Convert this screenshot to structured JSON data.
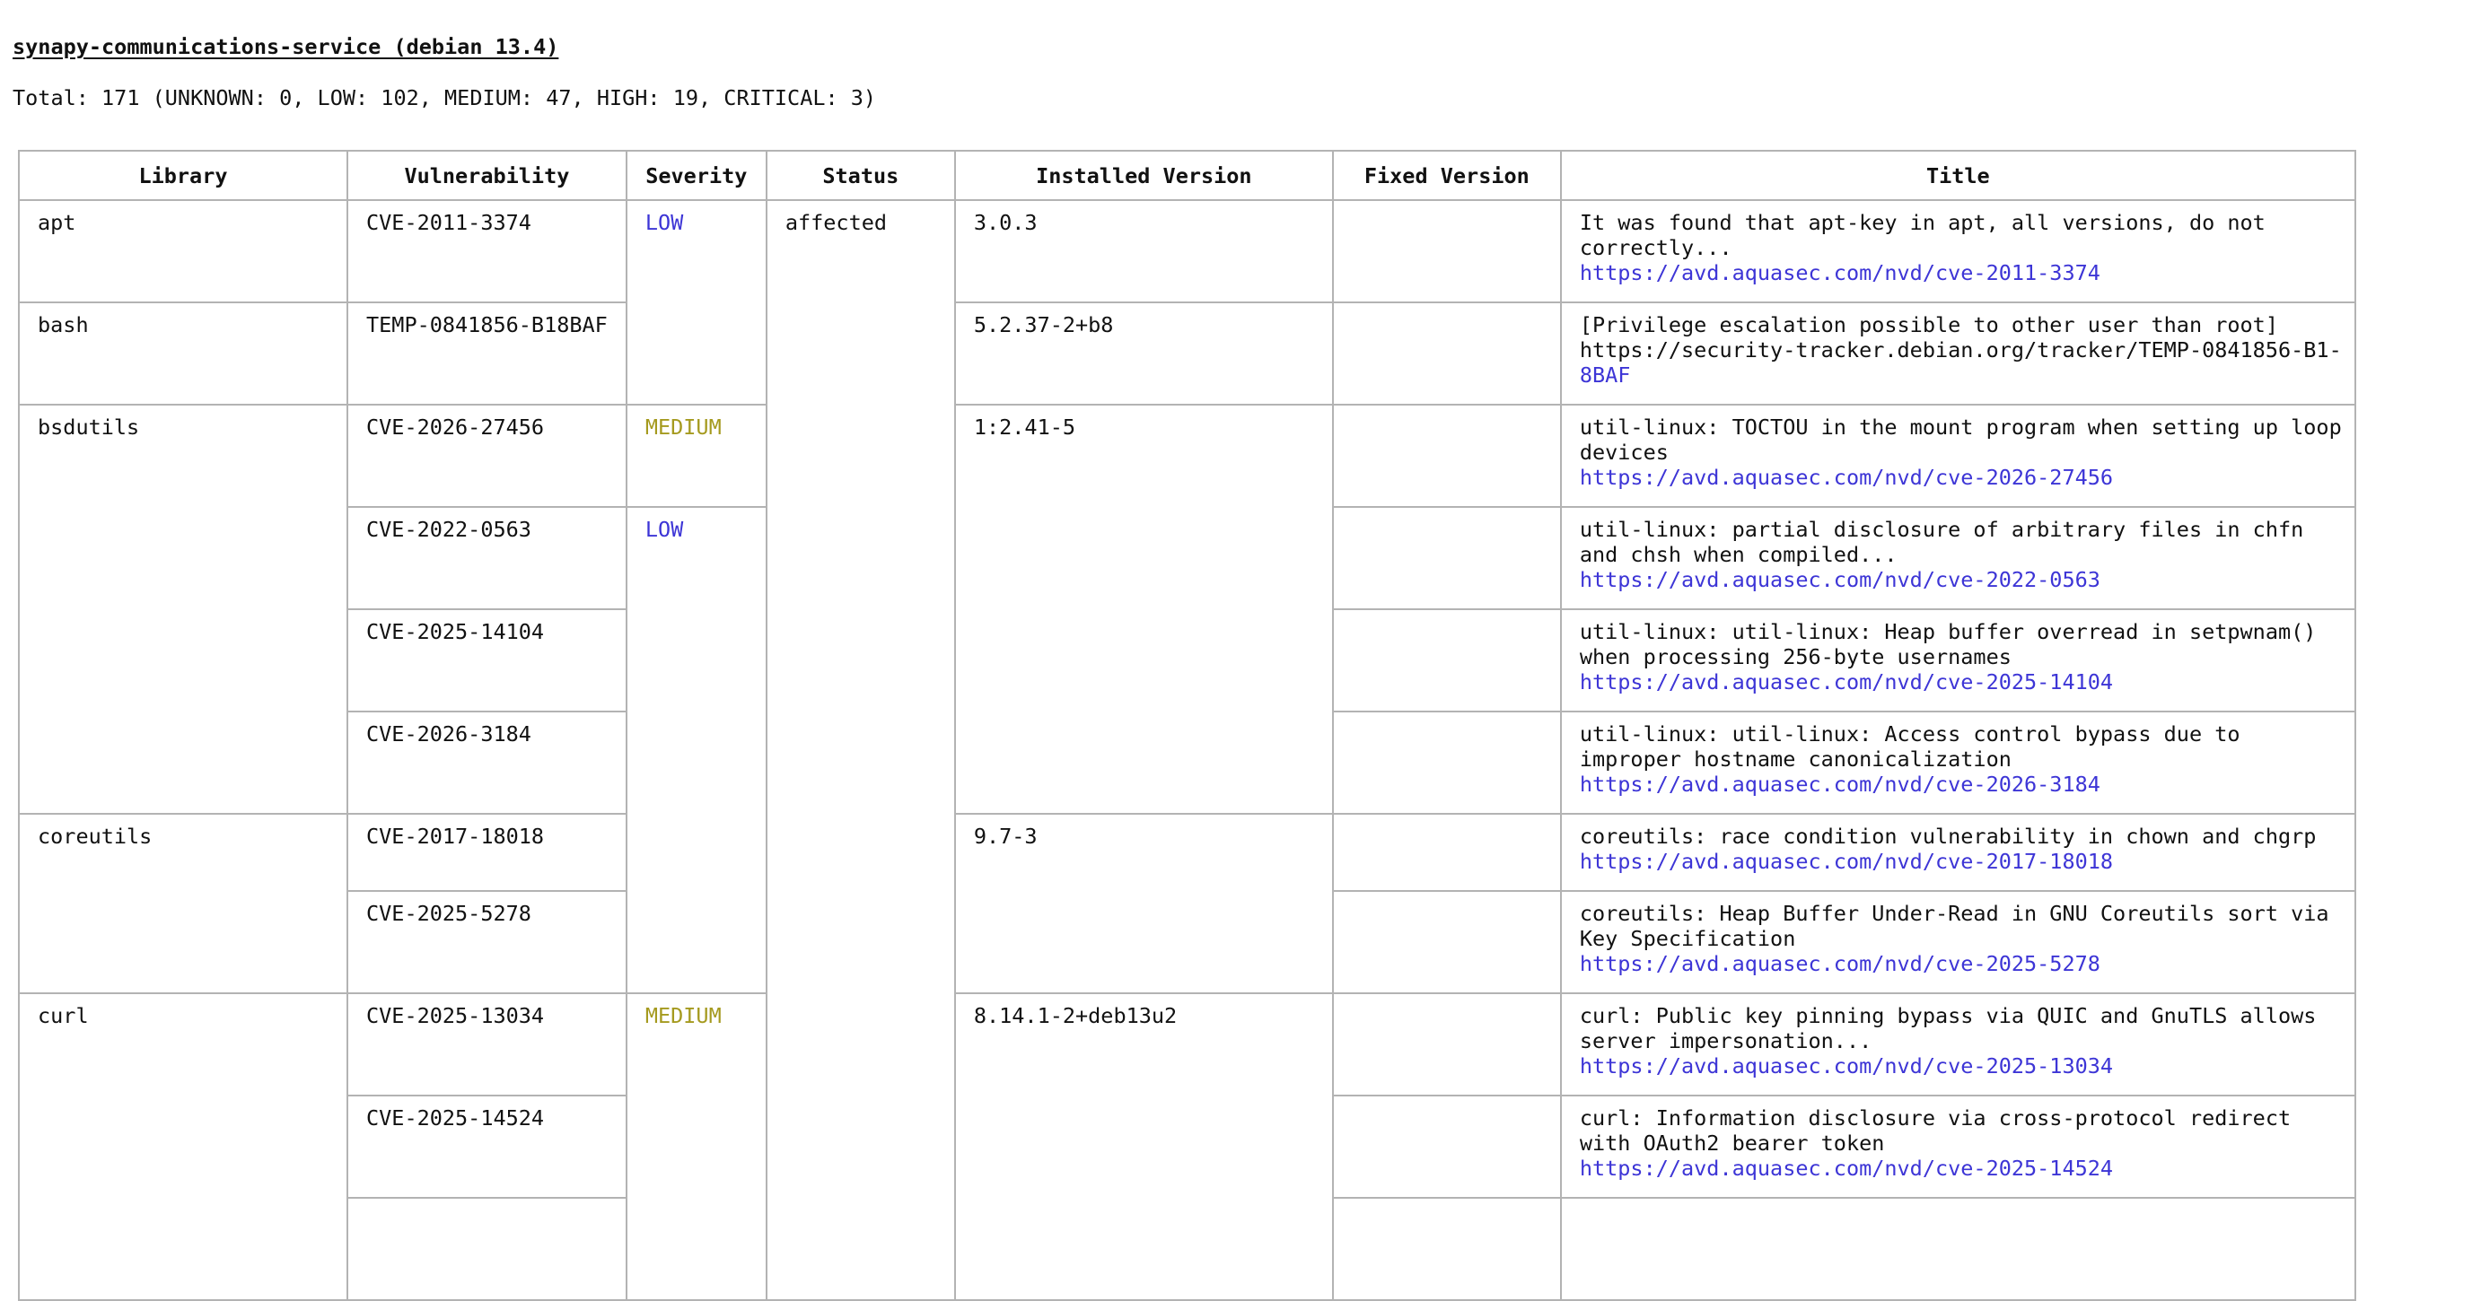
{
  "report": {
    "title": "synapy-communications-service (debian 13.4)",
    "summary": "Total: 171 (UNKNOWN: 0, LOW: 102, MEDIUM: 47, HIGH: 19, CRITICAL: 3)"
  },
  "table": {
    "headers": [
      "Library",
      "Vulnerability",
      "Severity",
      "Status",
      "Installed Version",
      "Fixed Version",
      "Title"
    ],
    "status_affected": "affected",
    "rows": [
      {
        "library": "apt",
        "vuln": "CVE-2011-3374",
        "severity": "LOW",
        "installed": "3.0.3",
        "fixed": "",
        "title": "It was found that apt-key in apt, all versions, do not correctly...",
        "link": "https://avd.aquasec.com/nvd/cve-2011-3374"
      },
      {
        "library": "bash",
        "vuln": "TEMP-0841856-B18BAF",
        "severity": "",
        "installed": "5.2.37-2+b8",
        "fixed": "",
        "title": "[Privilege escalation possible to other user than root]",
        "link_plain": "https://security-tracker.debian.org/tracker/TEMP-0841856-B1-",
        "link_tail": "8BAF"
      },
      {
        "library": "bsdutils",
        "vuln": "CVE-2026-27456",
        "severity": "MEDIUM",
        "installed": "1:2.41-5",
        "fixed": "",
        "title": "util-linux: TOCTOU in the mount program when setting up loop devices",
        "link": "https://avd.aquasec.com/nvd/cve-2026-27456"
      },
      {
        "library": "",
        "vuln": "CVE-2022-0563",
        "severity": "LOW",
        "installed": "",
        "fixed": "",
        "title": "util-linux: partial disclosure of arbitrary files in chfn and chsh when compiled...",
        "link": "https://avd.aquasec.com/nvd/cve-2022-0563"
      },
      {
        "library": "",
        "vuln": "CVE-2025-14104",
        "severity": "",
        "installed": "",
        "fixed": "",
        "title": "util-linux: util-linux: Heap buffer overread in setpwnam() when processing 256-byte usernames",
        "link": "https://avd.aquasec.com/nvd/cve-2025-14104"
      },
      {
        "library": "",
        "vuln": "CVE-2026-3184",
        "severity": "",
        "installed": "",
        "fixed": "",
        "title": "util-linux: util-linux: Access control bypass due to improper hostname canonicalization",
        "link": "https://avd.aquasec.com/nvd/cve-2026-3184"
      },
      {
        "library": "coreutils",
        "vuln": "CVE-2017-18018",
        "severity": "",
        "installed": "9.7-3",
        "fixed": "",
        "title": "coreutils: race condition vulnerability in chown and chgrp",
        "link": "https://avd.aquasec.com/nvd/cve-2017-18018"
      },
      {
        "library": "",
        "vuln": "CVE-2025-5278",
        "severity": "",
        "installed": "",
        "fixed": "",
        "title": "coreutils: Heap Buffer Under-Read in GNU Coreutils sort via Key Specification",
        "link": "https://avd.aquasec.com/nvd/cve-2025-5278"
      },
      {
        "library": "curl",
        "vuln": "CVE-2025-13034",
        "severity": "MEDIUM",
        "installed": "8.14.1-2+deb13u2",
        "fixed": "",
        "title": "curl: Public key pinning bypass via QUIC and GnuTLS allows server impersonation...",
        "link": "https://avd.aquasec.com/nvd/cve-2025-13034"
      },
      {
        "library": "",
        "vuln": "CVE-2025-14524",
        "severity": "",
        "installed": "",
        "fixed": "",
        "title": "curl: Information disclosure via cross-protocol redirect with OAuth2 bearer token",
        "link": "https://avd.aquasec.com/nvd/cve-2025-14524"
      },
      {
        "library": "",
        "vuln": "",
        "severity": "",
        "installed": "",
        "fixed": "",
        "title": "",
        "link": ""
      }
    ]
  },
  "colors": {
    "low": "#3d35d6",
    "medium": "#a59a1f",
    "link": "#3d35d6",
    "border": "#b3b3b3"
  }
}
